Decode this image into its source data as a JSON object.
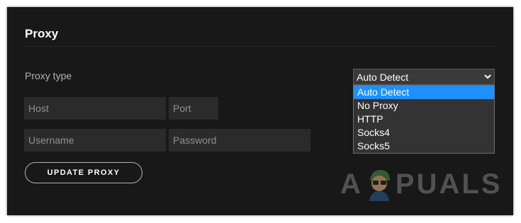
{
  "section": {
    "title": "Proxy"
  },
  "proxy_type": {
    "label": "Proxy type",
    "selected": "Auto Detect",
    "options": [
      "Auto Detect",
      "No Proxy",
      "HTTP",
      "Socks4",
      "Socks5"
    ]
  },
  "fields": {
    "host_placeholder": "Host",
    "port_placeholder": "Port",
    "username_placeholder": "Username",
    "password_placeholder": "Password"
  },
  "button": {
    "label": "UPDATE PROXY"
  },
  "watermark": {
    "text_left": "A",
    "text_right": "PUALS"
  },
  "colors": {
    "panel_bg": "#181818",
    "highlight": "#1e90ff",
    "field_bg": "#2b2b2b"
  }
}
